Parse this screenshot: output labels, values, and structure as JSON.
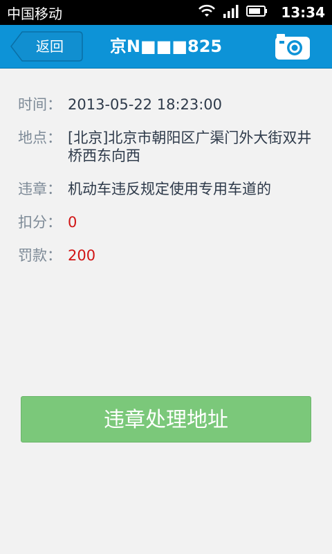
{
  "status_bar": {
    "carrier": "中国移动",
    "time": "13:34"
  },
  "nav": {
    "back_label": "返回",
    "title": "京N■■■825",
    "camera_icon": "camera-icon"
  },
  "colors": {
    "nav_bg": "#0d93d7",
    "action_bg": "#7bc87a",
    "label": "#7d8a97",
    "value": "#2e3a4a",
    "highlight": "#d11515"
  },
  "details": {
    "time_label": "时间：",
    "time_value": "2013-05-22 18:23:00",
    "location_label": "地点：",
    "location_value": "[北京]北京市朝阳区广渠门外大街双井桥西东向西",
    "violation_label": "违章：",
    "violation_value": "机动车违反规定使用专用车道的",
    "points_label": "扣分：",
    "points_value": "0",
    "fine_label": "罚款：",
    "fine_value": "200"
  },
  "action": {
    "label": "违章处理地址"
  }
}
